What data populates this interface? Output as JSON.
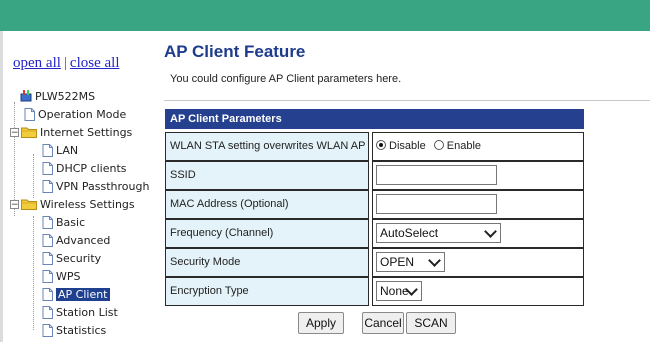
{
  "sidebar": {
    "open_all": "open all",
    "separator": "|",
    "close_all": "close all",
    "root": "PLW522MS",
    "items": [
      {
        "label": "Operation Mode"
      },
      {
        "label": "Internet Settings"
      },
      {
        "label": "LAN"
      },
      {
        "label": "DHCP clients"
      },
      {
        "label": "VPN Passthrough"
      },
      {
        "label": "Wireless Settings"
      },
      {
        "label": "Basic"
      },
      {
        "label": "Advanced"
      },
      {
        "label": "Security"
      },
      {
        "label": "WPS"
      },
      {
        "label": "AP Client"
      },
      {
        "label": "Station List"
      },
      {
        "label": "Statistics"
      }
    ]
  },
  "main": {
    "title": "AP Client Feature",
    "description": "You could configure AP Client parameters here.",
    "table_header": "AP Client Parameters",
    "rows": {
      "overwrite_label": "WLAN STA setting overwrites WLAN AP setting",
      "disable_label": "Disable",
      "enable_label": "Enable",
      "ssid_label": "SSID",
      "ssid_value": "",
      "mac_label": "MAC Address (Optional)",
      "mac_value": "",
      "frequency_label": "Frequency (Channel)",
      "frequency_value": "AutoSelect",
      "security_label": "Security Mode",
      "security_value": "OPEN",
      "encryption_label": "Encryption Type",
      "encryption_value": "None"
    },
    "buttons": {
      "apply": "Apply",
      "cancel": "Cancel",
      "scan": "SCAN"
    }
  },
  "colors": {
    "top_bar": "#3aa582",
    "title": "#1e3c8c",
    "table_header": "#25408f",
    "label_cell": "#e4f3f9",
    "selected_item": "#1f3f8f"
  },
  "icons": {
    "root": "router-icon",
    "folder": "folder-icon",
    "page": "document-icon"
  }
}
